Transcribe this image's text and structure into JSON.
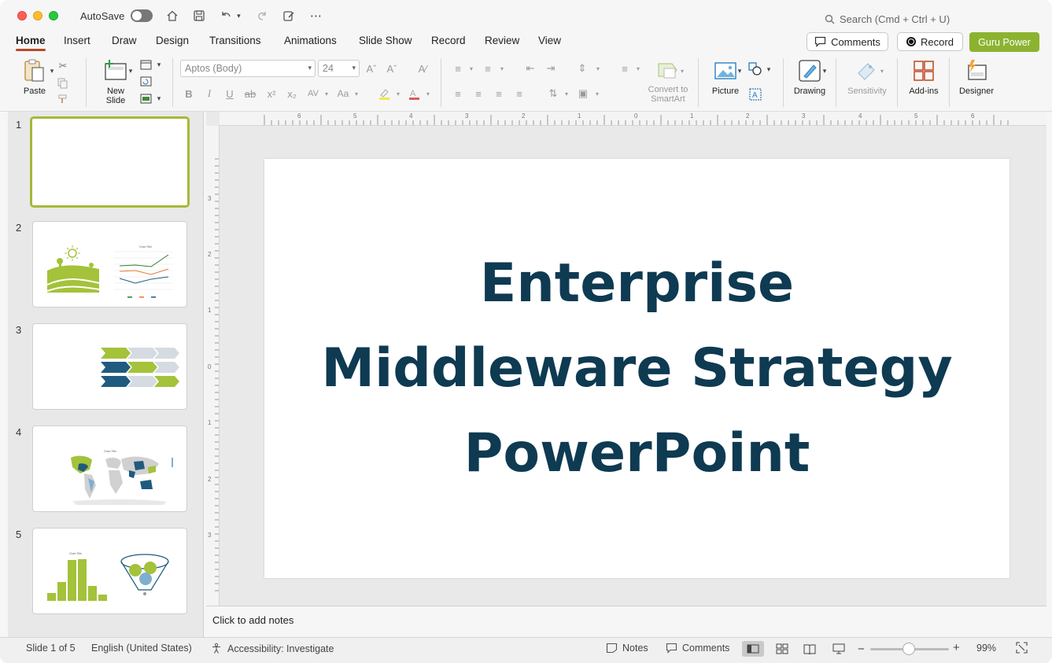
{
  "titlebar": {
    "autosave_label": "AutoSave",
    "search_placeholder": "Search (Cmd + Ctrl + U)"
  },
  "tabs": [
    "Home",
    "Insert",
    "Draw",
    "Design",
    "Transitions",
    "Animations",
    "Slide Show",
    "Record",
    "Review",
    "View"
  ],
  "active_tab": "Home",
  "header_buttons": {
    "comments": "Comments",
    "record": "Record",
    "guru": "Guru Power"
  },
  "ribbon": {
    "paste": "Paste",
    "new_slide_line1": "New",
    "new_slide_line2": "Slide",
    "font_name": "Aptos (Body)",
    "font_size": "24",
    "convert_line1": "Convert to",
    "convert_line2": "SmartArt",
    "picture": "Picture",
    "drawing": "Drawing",
    "sensitivity": "Sensitivity",
    "addins": "Add-ins",
    "designer": "Designer"
  },
  "thumbnails": [
    {
      "number": "1"
    },
    {
      "number": "2",
      "chart_title": "Chart Title"
    },
    {
      "number": "3"
    },
    {
      "number": "4",
      "chart_title": "Chart Title"
    },
    {
      "number": "5",
      "chart_title": "Chart Title"
    }
  ],
  "ruler": {
    "h_labels": [
      "6",
      "5",
      "4",
      "3",
      "2",
      "1",
      "0",
      "1",
      "2",
      "3",
      "4",
      "5",
      "6"
    ],
    "v_labels": [
      "3",
      "2",
      "1",
      "0",
      "1",
      "2",
      "3"
    ]
  },
  "slide": {
    "title_line1": "Enterprise",
    "title_line2": "Middleware Strategy",
    "title_line3": "PowerPoint"
  },
  "notes_placeholder": "Click to add notes",
  "status": {
    "slide_position": "Slide 1 of 5",
    "language": "English (United States)",
    "accessibility": "Accessibility: Investigate",
    "notes": "Notes",
    "comments": "Comments",
    "zoom": "99%"
  },
  "colors": {
    "accent_red": "#b7472a",
    "brand_green": "#8cb330",
    "title_navy": "#0e3a52",
    "thumb_green": "#a4c23a",
    "thumb_blue": "#1f5b7f"
  }
}
